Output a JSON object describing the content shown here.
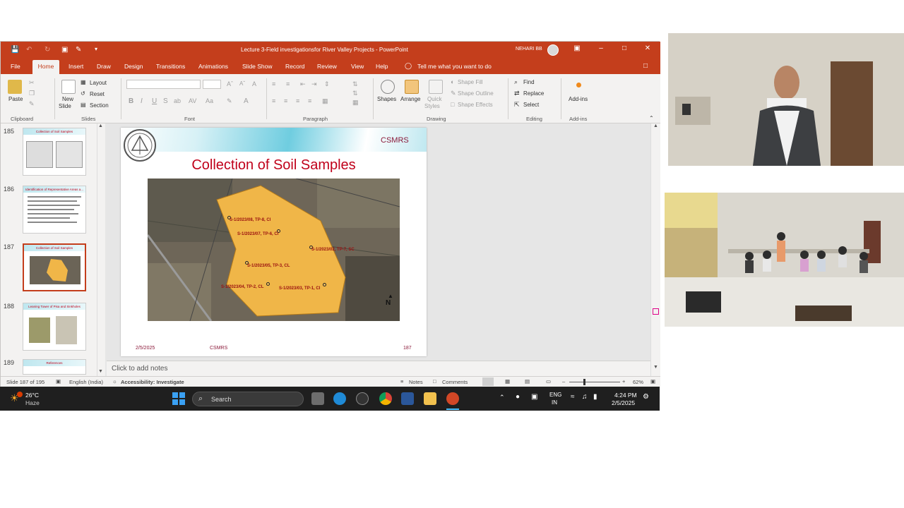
{
  "window": {
    "title": "Lecture 3-Field investigationsfor River Valley Projects  -  PowerPoint",
    "user": "NEHARI BB"
  },
  "menu": [
    "File",
    "Home",
    "Insert",
    "Draw",
    "Design",
    "Transitions",
    "Animations",
    "Slide Show",
    "Record",
    "Review",
    "View",
    "Help"
  ],
  "tell_me": "Tell me what you want to do",
  "ribbon": {
    "clipboard": {
      "paste": "Paste",
      "label": "Clipboard"
    },
    "slides": {
      "new_slide_1": "New",
      "new_slide_2": "Slide",
      "layout": "Layout",
      "reset": "Reset",
      "section": "Section",
      "label": "Slides"
    },
    "font": {
      "label": "Font"
    },
    "paragraph": {
      "label": "Paragraph"
    },
    "drawing": {
      "shapes": "Shapes",
      "arrange": "Arrange",
      "quick_styles_1": "Quick",
      "quick_styles_2": "Styles",
      "shape_fill": "Shape Fill",
      "shape_outline": "Shape Outline",
      "shape_effects": "Shape Effects",
      "label": "Drawing"
    },
    "editing": {
      "find": "Find",
      "replace": "Replace",
      "select": "Select",
      "label": "Editing"
    },
    "addins": {
      "addins": "Add-ins",
      "label": "Add-ins"
    }
  },
  "thumbnails": [
    {
      "num": "185",
      "title": "Collection of Soil Samples"
    },
    {
      "num": "186",
      "title": "Identification of Representative Areas a..."
    },
    {
      "num": "187",
      "title": "Collection of Soil Samples"
    },
    {
      "num": "188",
      "title": "Leaning Tower of Pisa and Sinkholes"
    },
    {
      "num": "189",
      "title": "References"
    }
  ],
  "slide": {
    "org": "CSMRS",
    "title": "Collection of Soil Samples",
    "date": "2/5/2025",
    "footer_org": "CSMRS",
    "number": "187",
    "north": "N",
    "map_labels": [
      "S-1/2023/08, TP-8, CI",
      "S-1/2023/07, TP-6, CI",
      "S-1/2023/02, TP-7, SC",
      "S-1/2023/05, TP-3, CL",
      "S-1/2023/04, TP-2, CL",
      "S-1/2023/03, TP-1, CI"
    ]
  },
  "notes_placeholder": "Click to add notes",
  "status": {
    "slide_of": "Slide 187 of 195",
    "language": "English (India)",
    "accessibility": "Accessibility: Investigate",
    "notes": "Notes",
    "comments": "Comments",
    "zoom": "62%"
  },
  "taskbar": {
    "weather_temp": "26°C",
    "weather_desc": "Haze",
    "search": "Search",
    "lang_1": "ENG",
    "lang_2": "IN",
    "time": "4:24 PM",
    "date": "2/5/2025"
  },
  "colors": {
    "accent": "#c43e1c",
    "slide_title": "#c0001a",
    "taskbar": "#1f1f1f"
  }
}
